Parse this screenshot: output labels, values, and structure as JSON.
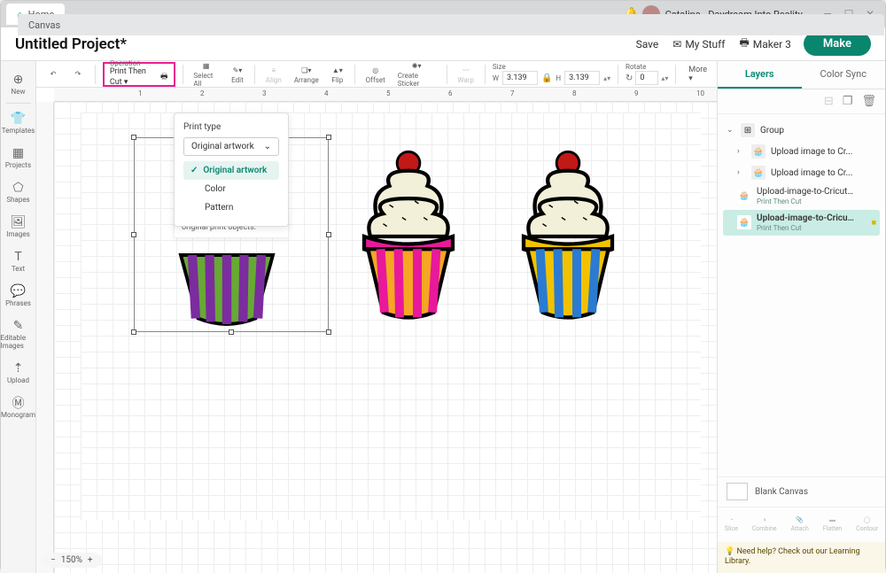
{
  "topbar": {
    "home": "Home",
    "canvas": "Canvas",
    "profile": "Catalina - Daydream Into Reality"
  },
  "titlebar": {
    "title": "Untitled Project*",
    "save": "Save",
    "mystuff": "My Stuff",
    "machine": "Maker 3",
    "make": "Make"
  },
  "rail": [
    {
      "label": "New",
      "icon": "⊕"
    },
    {
      "label": "Templates",
      "icon": "👕"
    },
    {
      "label": "Projects",
      "icon": "▦"
    },
    {
      "label": "Shapes",
      "icon": "⬠"
    },
    {
      "label": "Images",
      "icon": "🖼"
    },
    {
      "label": "Text",
      "icon": "T"
    },
    {
      "label": "Phrases",
      "icon": "💬"
    },
    {
      "label": "Editable Images",
      "icon": "✎"
    },
    {
      "label": "Upload",
      "icon": "⇡"
    },
    {
      "label": "Monogram",
      "icon": "Ⓜ"
    }
  ],
  "toolbar": {
    "undo": "↶",
    "redo": "↷",
    "operation_label": "Operation",
    "operation_value": "Print Then Cut ▾",
    "selectall": "Select All",
    "edit": "Edit",
    "align": "Align",
    "arrange": "Arrange",
    "flip": "Flip",
    "offset": "Offset",
    "createsticker": "Create Sticker",
    "warp": "Warp",
    "size": "Size",
    "w_label": "W",
    "h_label": "H",
    "w": "3.139",
    "h": "3.139",
    "rotate": "Rotate",
    "rotate_val": "0",
    "more": "More ▾"
  },
  "popup": {
    "title": "Print type",
    "select": "Original artwork",
    "options": [
      "Original artwork",
      "Color",
      "Pattern"
    ],
    "hint": "original print objects."
  },
  "ruler_ticks": [
    "1",
    "2",
    "3",
    "4",
    "5",
    "6",
    "7",
    "8",
    "9",
    "10"
  ],
  "zoom": "150%",
  "rpanel": {
    "tab1": "Layers",
    "tab2": "Color Sync",
    "group": "Group",
    "items": [
      {
        "name": "Upload image to Cr..."
      },
      {
        "name": "Upload image to Cr..."
      }
    ],
    "sub_items": [
      {
        "name": "Upload-image-to-Cricut...",
        "op": "Print Then Cut"
      },
      {
        "name": "Upload-image-to-Cricu...",
        "op": "Print Then Cut"
      }
    ],
    "swatch": "Blank Canvas",
    "bops": [
      "Slice",
      "Combine",
      "Attach",
      "Flatten",
      "Contour"
    ],
    "help": "Need help? Check out our Learning Library."
  }
}
